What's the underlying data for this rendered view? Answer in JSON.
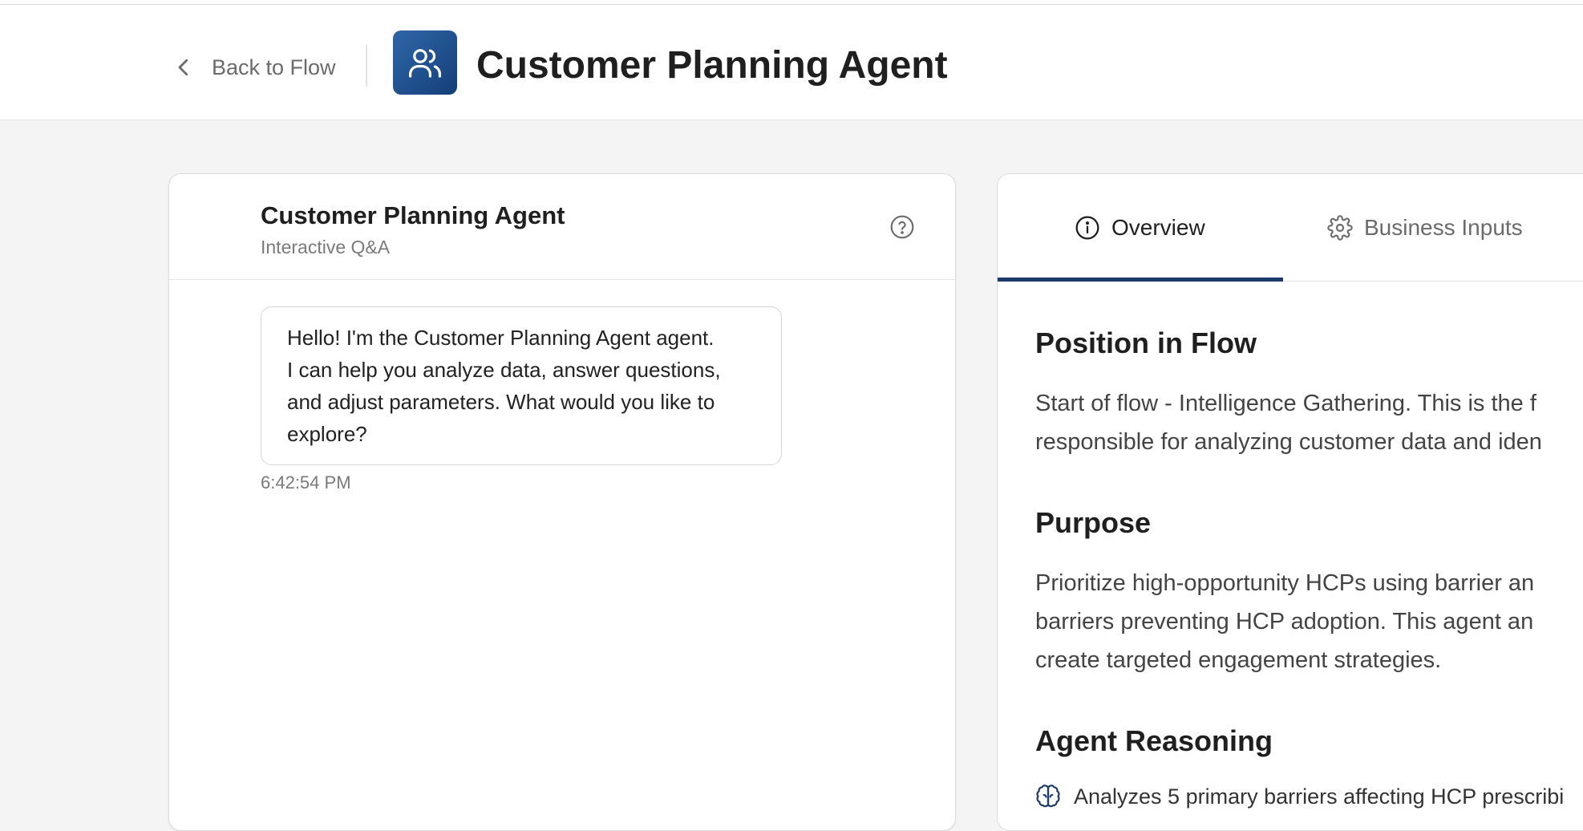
{
  "header": {
    "back_label": "Back to Flow",
    "title": "Customer Planning Agent",
    "icon": "users-icon",
    "icon_tile_color": "#1f4f8e"
  },
  "chat": {
    "title": "Customer Planning Agent",
    "subtitle": "Interactive Q&A",
    "help_icon": "help-circle-icon",
    "messages": [
      {
        "lines": [
          "Hello! I'm the Customer Planning Agent agent.",
          "I can help you analyze data, answer questions,",
          "and adjust parameters. What would you like to",
          "explore?"
        ],
        "time": "6:42:54 PM"
      }
    ]
  },
  "info": {
    "tabs": [
      {
        "label": "Overview",
        "icon": "info-icon",
        "active": true
      },
      {
        "label": "Business Inputs",
        "icon": "gear-icon",
        "active": false
      }
    ],
    "accent_color": "#1b3a6b",
    "sections": {
      "position": {
        "heading": "Position in Flow",
        "lines": [
          "Start of flow - Intelligence Gathering. This is the f",
          "responsible for analyzing customer data and iden"
        ]
      },
      "purpose": {
        "heading": "Purpose",
        "lines": [
          "Prioritize high-opportunity HCPs using barrier an",
          "barriers preventing HCP adoption. This agent an",
          "create targeted engagement strategies."
        ]
      },
      "reasoning": {
        "heading": "Agent Reasoning",
        "items": [
          {
            "icon": "brain-icon",
            "text": "Analyzes 5 primary barriers affecting HCP prescribi"
          }
        ]
      }
    }
  }
}
